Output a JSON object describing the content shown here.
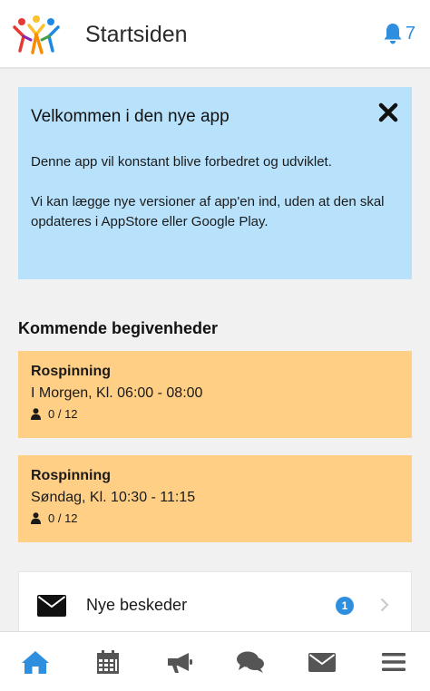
{
  "header": {
    "title": "Startsiden",
    "notification_count": "7",
    "logo": "people-logo",
    "accent": "#2e8fde"
  },
  "welcome": {
    "title": "Velkommen i den nye app",
    "paragraph1": "Denne app vil konstant blive forbedret og udviklet.",
    "paragraph2": "Vi kan lægge nye versioner af app'en ind, uden at den skal opdateres i AppStore eller Google Play.",
    "close_icon": "close-icon",
    "background": "#b8e2fb"
  },
  "events_section": {
    "title": "Kommende begivenheder",
    "card_color": "#ffcf85",
    "items": [
      {
        "title": "Rospinning",
        "time": "I Morgen, Kl. 06:00 - 08:00",
        "count": "0 / 12"
      },
      {
        "title": "Rospinning",
        "time": "Søndag, Kl. 10:30 - 11:15",
        "count": "0 / 12"
      }
    ]
  },
  "messages": {
    "label": "Nye beskeder",
    "badge": "1",
    "icon": "envelope-icon"
  },
  "bottom_nav": {
    "items": [
      {
        "icon": "home-icon",
        "active": true
      },
      {
        "icon": "calendar-icon",
        "active": false
      },
      {
        "icon": "megaphone-icon",
        "active": false
      },
      {
        "icon": "chat-icon",
        "active": false
      },
      {
        "icon": "envelope-icon",
        "active": false
      },
      {
        "icon": "menu-icon",
        "active": false
      }
    ],
    "active_color": "#2e8fde",
    "inactive_color": "#555555"
  }
}
